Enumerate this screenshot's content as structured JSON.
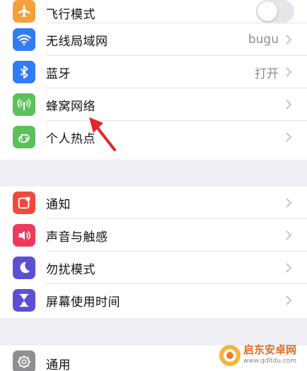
{
  "group1": {
    "airplane": {
      "label": "飞行模式",
      "icon": "airplane-icon",
      "color": "#f7a03a",
      "toggle_on": false
    },
    "wifi": {
      "label": "无线局域网",
      "value": "bugu",
      "icon": "wifi-icon",
      "color": "#2f7cf6"
    },
    "bluetooth": {
      "label": "蓝牙",
      "value": "打开",
      "icon": "bluetooth-icon",
      "color": "#2f7cf6"
    },
    "cellular": {
      "label": "蜂窝网络",
      "icon": "cellular-icon",
      "color": "#5cc15c"
    },
    "hotspot": {
      "label": "个人热点",
      "icon": "hotspot-icon",
      "color": "#5cc15c"
    }
  },
  "group2": {
    "notifications": {
      "label": "通知",
      "icon": "notification-icon",
      "color": "#f04a3e"
    },
    "sounds": {
      "label": "声音与触感",
      "icon": "speaker-icon",
      "color": "#ee3b5b"
    },
    "dnd": {
      "label": "勿扰模式",
      "icon": "moon-icon",
      "color": "#5b4fd6"
    },
    "screentime": {
      "label": "屏幕使用时间",
      "icon": "hourglass-icon",
      "color": "#5b4fd6"
    }
  },
  "group3": {
    "general": {
      "label": "通用",
      "icon": "gear-icon",
      "color": "#8e8e93"
    }
  },
  "watermark": {
    "title": "启东安卓网",
    "url": "www.qdltdu.com"
  },
  "annotation": {
    "arrow_color": "#e32626"
  }
}
